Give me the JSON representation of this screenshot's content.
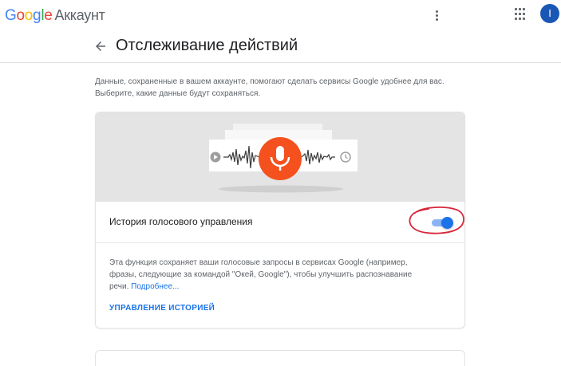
{
  "app": {
    "brand_letters": [
      {
        "ch": "G",
        "color": "#4285F4"
      },
      {
        "ch": "o",
        "color": "#EA4335"
      },
      {
        "ch": "o",
        "color": "#FBBC05"
      },
      {
        "ch": "g",
        "color": "#4285F4"
      },
      {
        "ch": "l",
        "color": "#34A853"
      },
      {
        "ch": "e",
        "color": "#EA4335"
      }
    ],
    "product": "Аккаунт"
  },
  "topbar": {
    "menu_icon": "more-vert-icon",
    "apps_icon": "apps-grid-icon",
    "avatar_letter": "I",
    "avatar_color": "#1a57b5"
  },
  "header": {
    "back_icon": "arrow-back-icon",
    "title": "Отслеживание действий"
  },
  "intro": {
    "text": "Данные, сохраненные в вашем аккаунте, помогают сделать сервисы Google удобнее для вас. Выберите, какие данные будут сохраняться."
  },
  "card": {
    "illustration_icon": "microphone-icon",
    "accent_color": "#f4511e",
    "setting_label": "История голосового управления",
    "toggle_on": true,
    "toggle_color": "#1a73e8",
    "annotation_color": "#d6263a",
    "description": "Эта функция сохраняет ваши голосовые запросы в сервисах Google (например, фразы, следующие за командой \"Окей, Google\"), чтобы улучшить распознавание речи.",
    "more_link": "Подробнее...",
    "manage_link": "УПРАВЛЕНИЕ ИСТОРИЕЙ"
  }
}
